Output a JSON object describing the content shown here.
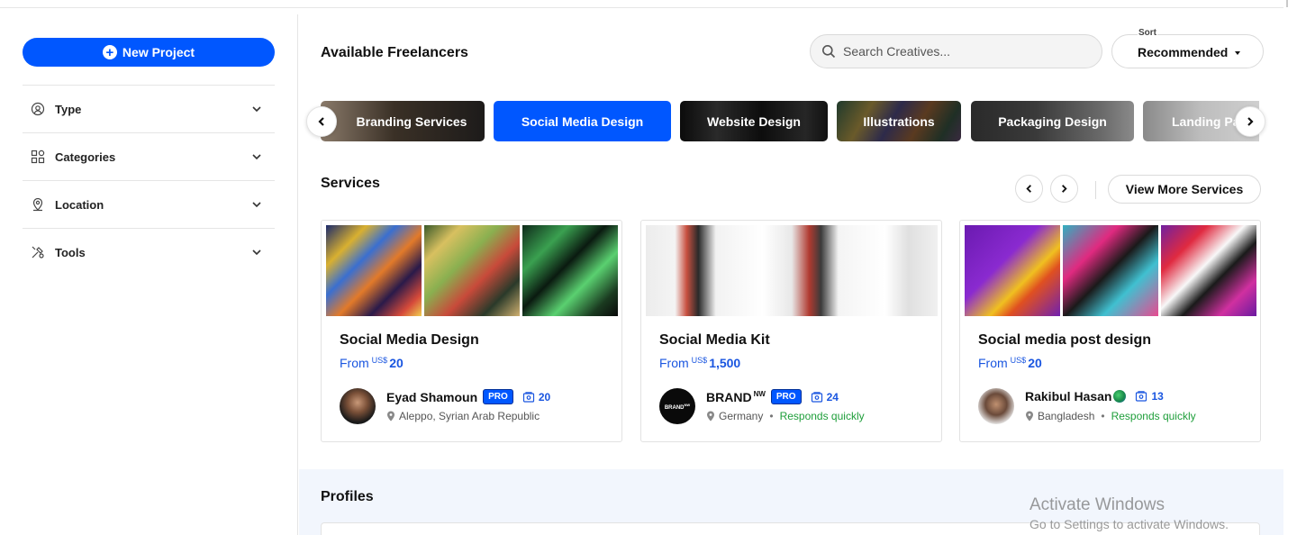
{
  "sidebar": {
    "new_project_label": "New Project",
    "filters": [
      {
        "label": "Type",
        "icon": "user-search-icon"
      },
      {
        "label": "Categories",
        "icon": "categories-icon"
      },
      {
        "label": "Location",
        "icon": "location-pin-icon"
      },
      {
        "label": "Tools",
        "icon": "tools-icon"
      }
    ]
  },
  "header": {
    "title": "Available Freelancers",
    "search_placeholder": "Search Creatives...",
    "sort_label": "Sort",
    "sort_value": "Recommended"
  },
  "categories": [
    {
      "label": "Branding Services",
      "active": false
    },
    {
      "label": "Social Media Design",
      "active": true
    },
    {
      "label": "Website Design",
      "active": false
    },
    {
      "label": "Illustrations",
      "active": false
    },
    {
      "label": "Packaging Design",
      "active": false
    },
    {
      "label": "Landing Pa",
      "active": false
    }
  ],
  "services": {
    "title": "Services",
    "view_more_label": "View More Services",
    "cards": [
      {
        "title": "Social Media Design",
        "price_prefix": "From",
        "currency": "US$",
        "price": "20",
        "user_name": "Eyad Shamoun",
        "user_suffix": "",
        "pro_badge": "PRO",
        "projects": "20",
        "location": "Aleppo, Syrian Arab Republic",
        "responds": ""
      },
      {
        "title": "Social Media Kit",
        "price_prefix": "From",
        "currency": "US$",
        "price": "1,500",
        "user_name": "BRAND",
        "user_suffix": "NW",
        "pro_badge": "PRO",
        "projects": "24",
        "location": "Germany",
        "responds": "Responds quickly"
      },
      {
        "title": "Social media post design",
        "price_prefix": "From",
        "currency": "US$",
        "price": "20",
        "user_name": "Rakibul Hasan",
        "user_suffix": "",
        "pro_badge": "",
        "projects": "13",
        "location": "Bangladesh",
        "responds": "Responds quickly"
      }
    ]
  },
  "profiles": {
    "title": "Profiles"
  },
  "watermark": {
    "line1": "Activate Windows",
    "line2": "Go to Settings to activate Windows."
  },
  "colors": {
    "accent": "#0057ff",
    "link": "#1a56e0",
    "success": "#1e9e3a"
  }
}
